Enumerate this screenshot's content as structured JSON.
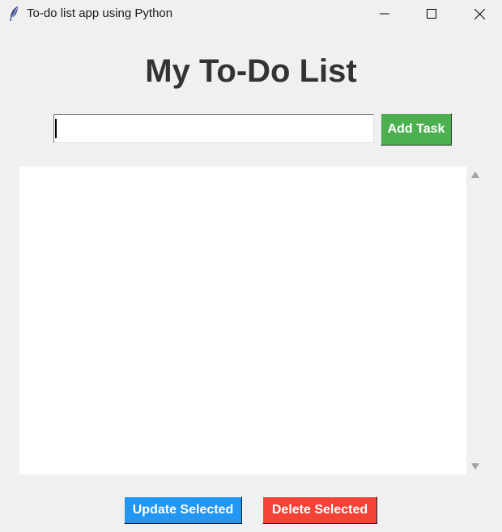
{
  "window": {
    "title": "To-do list app using Python",
    "icon": "feather-icon",
    "controls": [
      "minimize-icon",
      "maximize-icon",
      "close-icon"
    ]
  },
  "main": {
    "heading": "My To-Do List",
    "task_input": {
      "value": "",
      "placeholder": ""
    },
    "add_button_label": "Add Task",
    "tasks": [],
    "update_button_label": "Update Selected",
    "delete_button_label": "Delete Selected"
  },
  "colors": {
    "background": "#f0f0f0",
    "heading": "#333333",
    "add_button": "#4caf50",
    "update_button": "#2196f3",
    "delete_button": "#f44336"
  }
}
